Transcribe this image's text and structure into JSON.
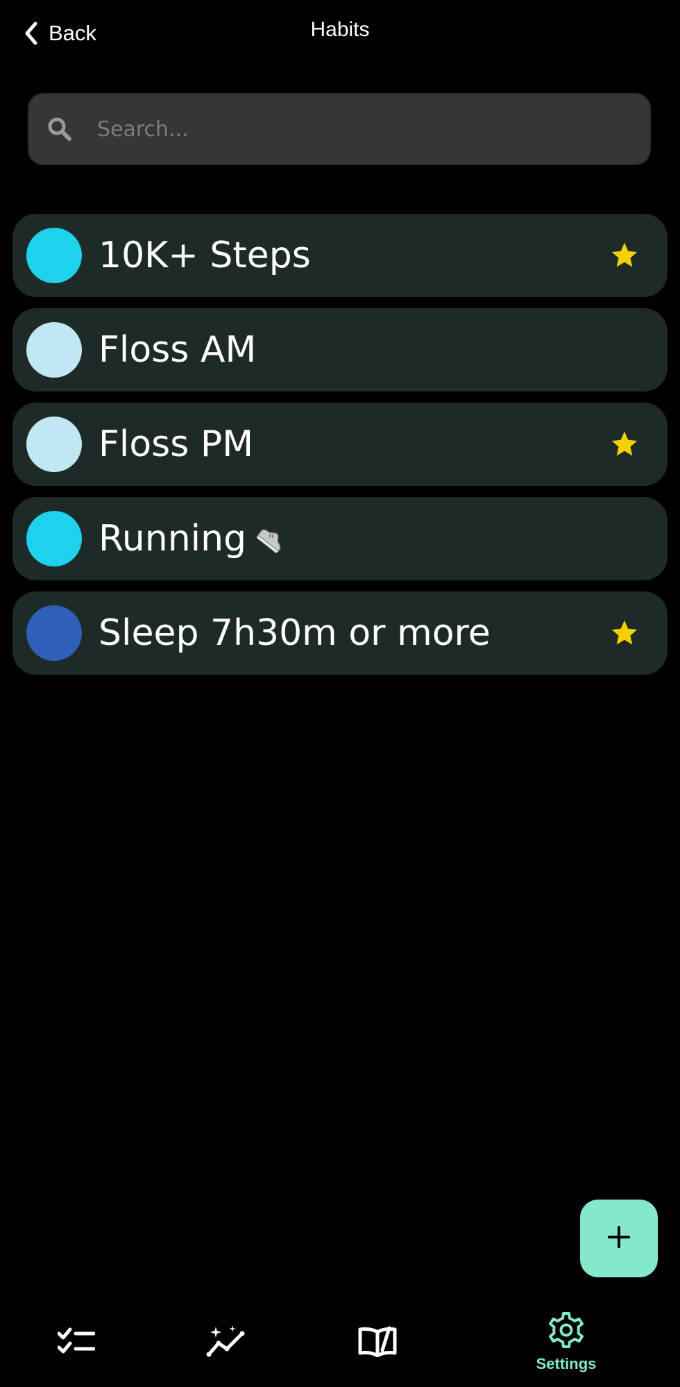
{
  "header": {
    "back_label": "Back",
    "title": "Habits"
  },
  "search": {
    "placeholder": "Search...",
    "value": ""
  },
  "habits": [
    {
      "name": "10K+ Steps",
      "color": "#1dd2ec",
      "favorite": true,
      "icon": ""
    },
    {
      "name": "Floss AM",
      "color": "#c1e8f2",
      "favorite": false,
      "icon": ""
    },
    {
      "name": "Floss PM",
      "color": "#c1e8f2",
      "favorite": true,
      "icon": ""
    },
    {
      "name": "Running",
      "color": "#1dd2ec",
      "favorite": false,
      "icon": "running-shoe-icon"
    },
    {
      "name": "Sleep 7h30m or more",
      "color": "#2f60b8",
      "favorite": true,
      "icon": ""
    }
  ],
  "fab": {
    "icon": "plus-icon",
    "color": "#84e8cc"
  },
  "nav": {
    "items": [
      {
        "icon": "checklist-icon",
        "label": ""
      },
      {
        "icon": "sparkle-chart-icon",
        "label": ""
      },
      {
        "icon": "open-book-icon",
        "label": ""
      },
      {
        "icon": "gear-icon",
        "label": "Settings",
        "active": true
      }
    ],
    "active_color": "#84e8cc"
  },
  "colors": {
    "background": "#000000",
    "card": "#1e2a27",
    "star": "#f5d000",
    "accent": "#84e8cc"
  }
}
